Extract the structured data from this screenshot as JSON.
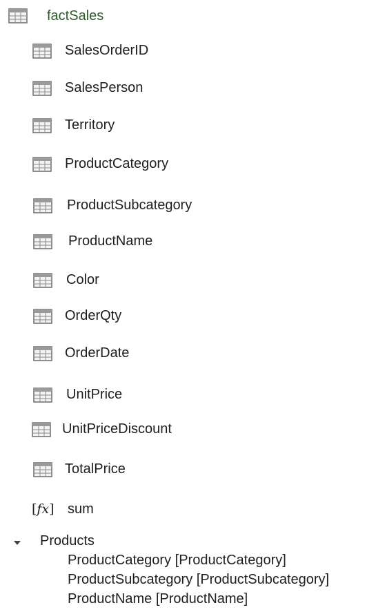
{
  "table": {
    "name": "factSales",
    "icon": "table-icon"
  },
  "columns": [
    {
      "label": "SalesOrderID",
      "icon": "column-icon"
    },
    {
      "label": "SalesPerson",
      "icon": "column-icon"
    },
    {
      "label": "Territory",
      "icon": "column-icon"
    },
    {
      "label": "ProductCategory",
      "icon": "column-icon"
    },
    {
      "label": "ProductSubcategory",
      "icon": "column-icon"
    },
    {
      "label": "ProductName",
      "icon": "column-icon"
    },
    {
      "label": "Color",
      "icon": "column-icon"
    },
    {
      "label": "OrderQty",
      "icon": "column-icon"
    },
    {
      "label": "OrderDate",
      "icon": "column-icon"
    },
    {
      "label": "UnitPrice",
      "icon": "column-icon"
    },
    {
      "label": "UnitPriceDiscount",
      "icon": "column-icon"
    },
    {
      "label": "TotalPrice",
      "icon": "column-icon"
    }
  ],
  "measure": {
    "icon_text": "[fx]",
    "label": "sum"
  },
  "hierarchy": {
    "name": "Products",
    "expanded": true,
    "levels": [
      "ProductCategory [ProductCategory]",
      "ProductSubcategory [ProductSubcategory]",
      "ProductName [ProductName]"
    ]
  }
}
